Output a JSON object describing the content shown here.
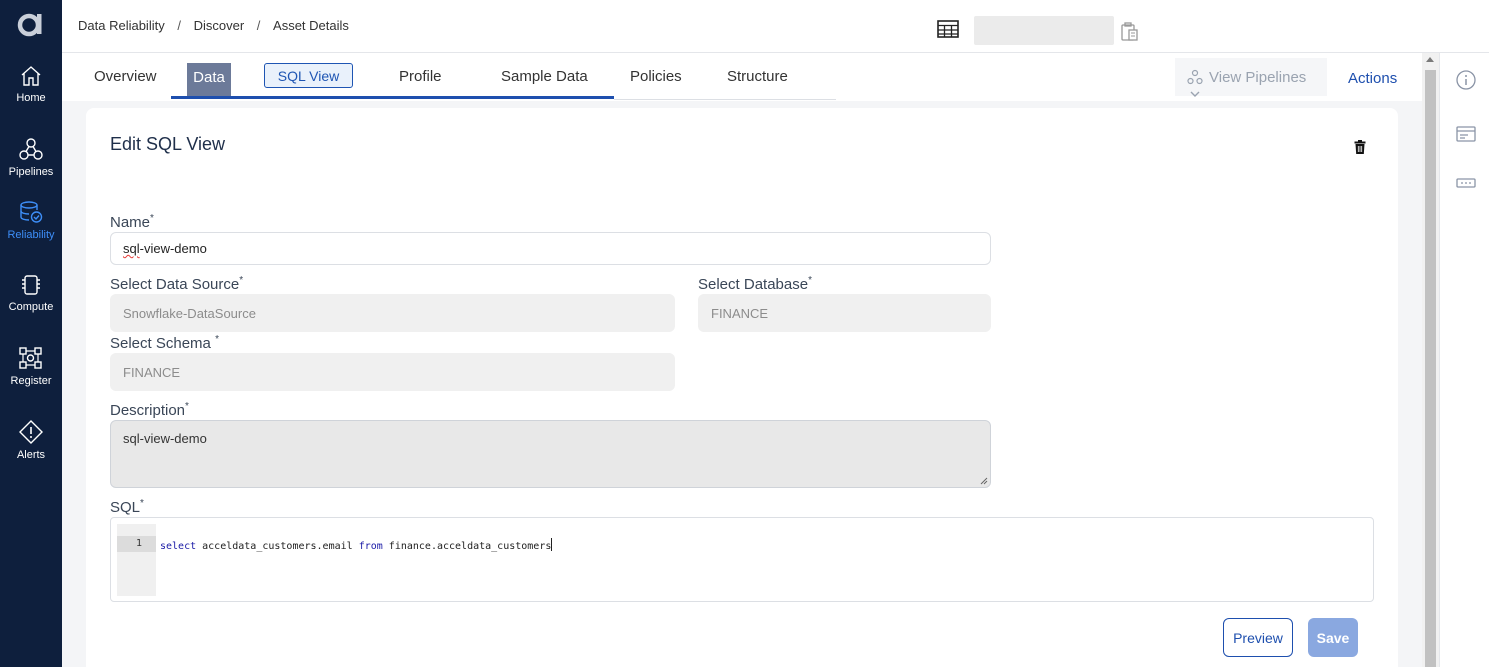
{
  "sidebar": {
    "logo_letter": "a",
    "items": [
      {
        "label": "Home",
        "icon": "home-icon"
      },
      {
        "label": "Pipelines",
        "icon": "pipelines-icon"
      },
      {
        "label": "Reliability",
        "icon": "reliability-icon",
        "active": true
      },
      {
        "label": "Compute",
        "icon": "compute-icon"
      },
      {
        "label": "Register",
        "icon": "register-icon"
      },
      {
        "label": "Alerts",
        "icon": "alert-icon"
      }
    ]
  },
  "breadcrumb": [
    "Data Reliability",
    "Discover",
    "Asset Details"
  ],
  "breadcrumb_sep": "/",
  "tabs": {
    "overview": "Overview",
    "data": "Data",
    "sql_view": "SQL View",
    "profile": "Profile",
    "sample_data": "Sample Data",
    "policies": "Policies",
    "structure": "Structure"
  },
  "view_pipelines": "View Pipelines",
  "actions": "Actions",
  "form": {
    "title": "Edit SQL View",
    "name_label": "Name",
    "name_value_err": "sql",
    "name_value_rest": "-view-demo",
    "datasource_label": "Select Data Source",
    "datasource_value": "Snowflake-DataSource",
    "database_label": "Select Database",
    "database_value": "FINANCE",
    "schema_label": "Select Schema",
    "schema_value": "FINANCE",
    "description_label": "Description",
    "description_value": "sql-view-demo",
    "sql_label": "SQL",
    "required_mark": "*",
    "sql_line_number": "1",
    "sql_kw_select": "select",
    "sql_part1": " acceldata_customers.email ",
    "sql_kw_from": "from",
    "sql_part2": " finance.acceldata_customers"
  },
  "buttons": {
    "preview": "Preview",
    "save": "Save"
  },
  "colors": {
    "sidebar_bg": "#0e1f3d",
    "accent": "#1e4fae",
    "active_nav": "#3d8ef8"
  }
}
